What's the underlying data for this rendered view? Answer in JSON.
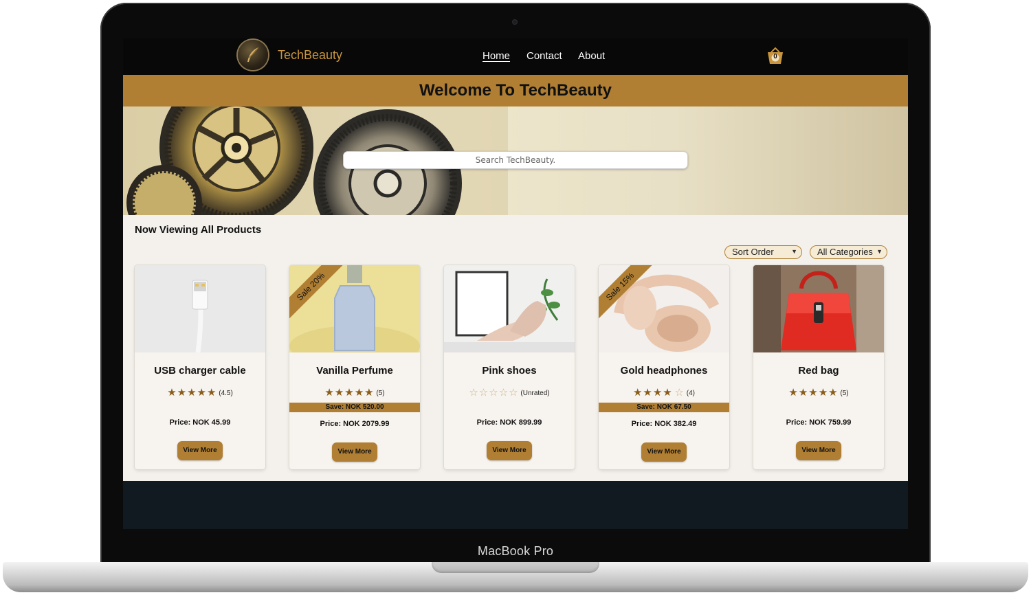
{
  "device": {
    "label": "MacBook Pro"
  },
  "navbar": {
    "brand": "TechBeauty",
    "links": [
      "Home",
      "Contact",
      "About"
    ],
    "cart_count": "0"
  },
  "banner": {
    "title": "Welcome To TechBeauty"
  },
  "search": {
    "placeholder": "Search TechBeauty."
  },
  "listing": {
    "heading": "Now Viewing All Products",
    "sort_label": "Sort Order",
    "category_label": "All Categories"
  },
  "products": [
    {
      "name": "USB charger cable",
      "stars": "★★★★★",
      "empty_stars": "",
      "rating": "(4.5)",
      "price": "Price: NOK 45.99",
      "button": "View More"
    },
    {
      "name": "Vanilla Perfume",
      "stars": "★★★★★",
      "empty_stars": "",
      "rating": "(5)",
      "sale": "Sale 20%",
      "save": "Save: NOK 520.00",
      "price": "Price: NOK 2079.99",
      "button": "View More"
    },
    {
      "name": "Pink shoes",
      "stars": "",
      "empty_stars": "☆☆☆☆☆",
      "rating": "(Unrated)",
      "price": "Price: NOK 899.99",
      "button": "View More"
    },
    {
      "name": "Gold headphones",
      "stars": "★★★★",
      "empty_stars": "☆",
      "rating": "(4)",
      "sale": "Sale 15%",
      "save": "Save: NOK 67.50",
      "price": "Price: NOK 382.49",
      "button": "View More"
    },
    {
      "name": "Red bag",
      "stars": "★★★★★",
      "empty_stars": "",
      "rating": "(5)",
      "price": "Price: NOK 759.99",
      "button": "View More"
    }
  ],
  "colors": {
    "accent": "#b07f33",
    "navbar": "#080808",
    "page": "#f4f1ec",
    "footer": "#111a21"
  },
  "icons": [
    "quill-logo-icon",
    "shopping-basket-icon",
    "chevron-down-icon",
    "star-icon"
  ]
}
